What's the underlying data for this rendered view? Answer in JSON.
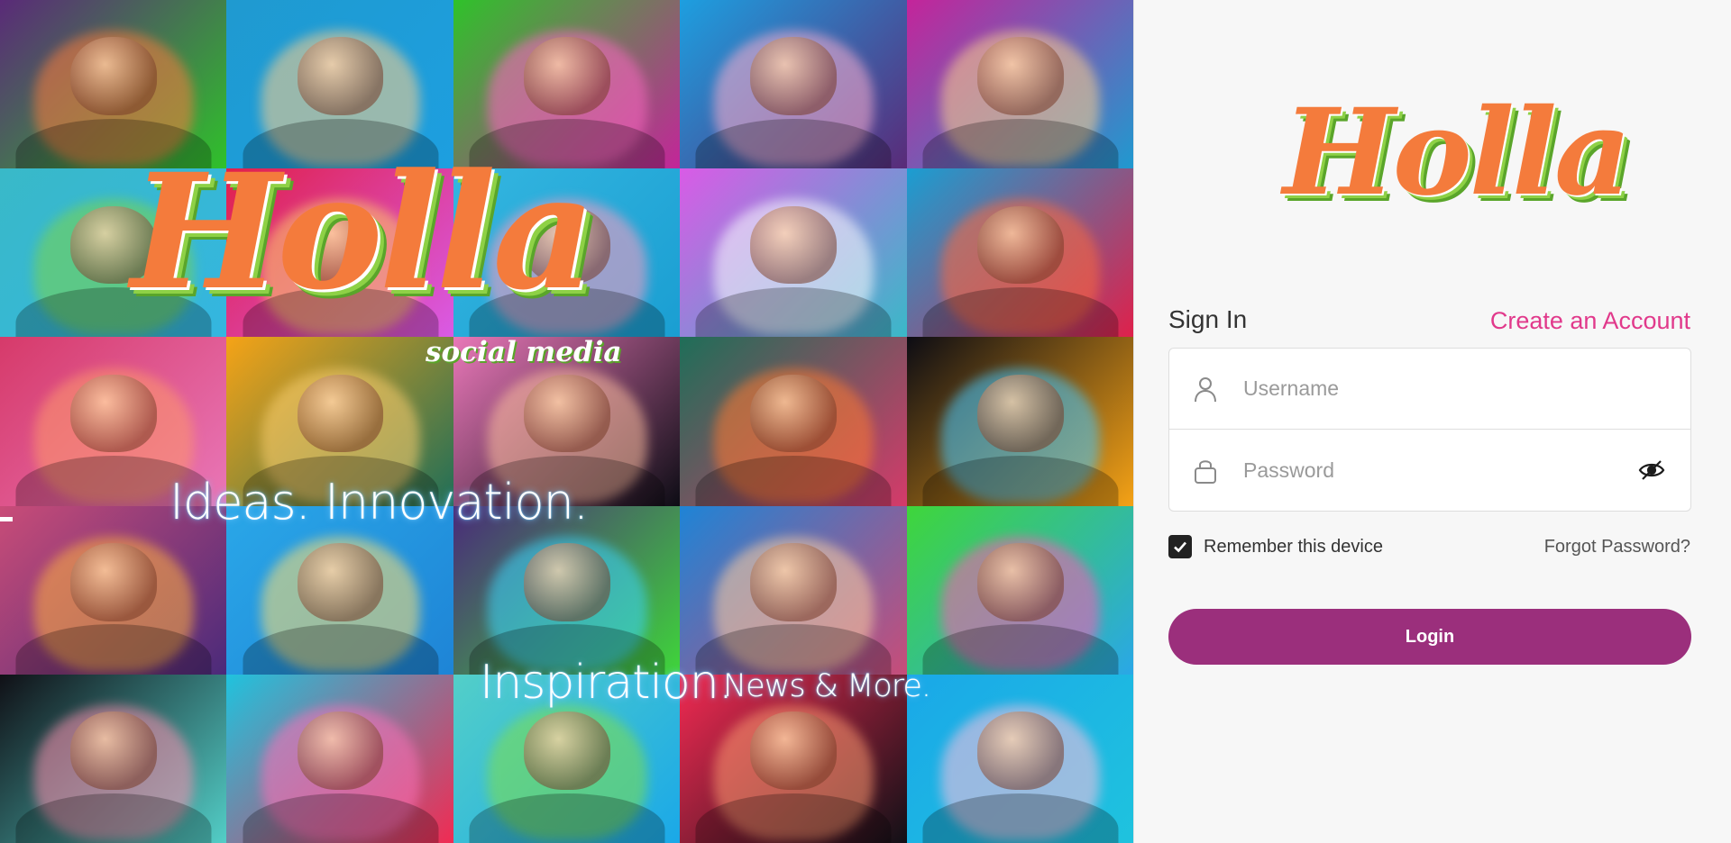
{
  "hero": {
    "logo_text": "Holla",
    "logo_subtext": "social media",
    "tagline_1": "Ideas. Innovation.",
    "tagline_2": "Inspiration.",
    "tagline_3": "News & More.",
    "tile_colors": [
      [
        "#5a2a78",
        "#1f9ad0",
        "#2fc22a",
        "#1d9fe0",
        "#c4249a"
      ],
      [
        "#39b9c8",
        "#e0204a",
        "#34b6e0",
        "#d95be6",
        "#1a9ed2"
      ],
      [
        "#d63a6a",
        "#f6a316",
        "#e977b8",
        "#1e6e58",
        "#0c0c14"
      ],
      [
        "#c94c78",
        "#2aa7e8",
        "#4a2a7a",
        "#1e84d6",
        "#3fd63a"
      ],
      [
        "#101016",
        "#1fc3de",
        "#53cfc8",
        "#f22a52",
        "#1aa8e8"
      ]
    ],
    "glow_colors": [
      [
        "#ff7a3c",
        "#ffd08a",
        "#ff66c4",
        "#ffb0d0",
        "#ffd08a"
      ],
      [
        "#7bd64a",
        "#ffcc66",
        "#ff9cc2",
        "#ffffff",
        "#ff6a3c"
      ],
      [
        "#ff9a6a",
        "#ffd070",
        "#ffc0a0",
        "#ff7a30",
        "#45c8ff"
      ],
      [
        "#ffb040",
        "#ffe070",
        "#3ad6ff",
        "#ffd0a0",
        "#ff5ab4"
      ],
      [
        "#ff90b0",
        "#ff70b8",
        "#7fe04a",
        "#ff9a70",
        "#ffc0e0"
      ]
    ]
  },
  "login": {
    "logo_text": "Holla",
    "signin_title": "Sign In",
    "create_account": "Create an Account",
    "username_placeholder": "Username",
    "password_placeholder": "Password",
    "remember_label": "Remember this device",
    "remember_checked": true,
    "forgot_password": "Forgot Password?",
    "login_button": "Login",
    "icons": {
      "username": "user-icon",
      "password": "lock-icon",
      "visibility": "eye-slash-icon",
      "checkbox": "checkmark-icon"
    },
    "colors": {
      "accent_link": "#e1398b",
      "login_button": "#9b2f7c",
      "logo_orange": "#f47b3c",
      "logo_green": "#8ed146"
    }
  }
}
